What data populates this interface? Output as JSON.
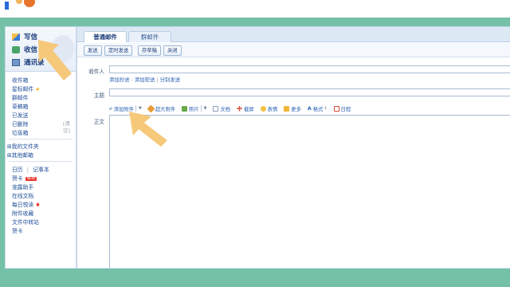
{
  "sidebar": {
    "quick": [
      {
        "label": "写信",
        "icon": "pen-icon"
      },
      {
        "label": "收信",
        "icon": "inbox-icon"
      },
      {
        "label": "通讯录",
        "icon": "address-book-icon"
      }
    ],
    "folders": [
      {
        "label": "收件箱"
      },
      {
        "label": "星标邮件",
        "star": "★"
      },
      {
        "label": "群邮件"
      },
      {
        "label": "草稿箱"
      },
      {
        "label": "已发送"
      },
      {
        "label": "已删除",
        "count": "[清空]"
      },
      {
        "label": "垃圾箱"
      }
    ],
    "groups": [
      {
        "label": "⊞我的文件夹"
      },
      {
        "label": "⊞其他邮箱"
      }
    ],
    "tools": {
      "calendar": "日历",
      "divider": "|",
      "notebook": "记事本",
      "postcard": "贺卡",
      "postcard_badge": "NEW",
      "reminder": "宠露助手",
      "docs": "在线文档",
      "daily": "每日悦读",
      "daily_mark": "●",
      "attach_fav": "附件收藏",
      "transfer": "文件中转站",
      "card": "贺卡"
    }
  },
  "main": {
    "tabs": [
      {
        "label": "普通邮件",
        "active": true
      },
      {
        "label": "群邮件",
        "active": false
      }
    ],
    "toolbar": {
      "send": "发送",
      "scheduled": "定时发送",
      "save_draft": "存草稿",
      "close": "关闭"
    },
    "recipient_label": "收件人",
    "recipient_links": {
      "cc": "添加抄送",
      "dot": "-",
      "bcc": "添加密送",
      "sep": "|",
      "separate": "分别发送"
    },
    "subject_label": "主题",
    "format": {
      "attach": "添加附件",
      "big_attach": "超大附件",
      "photo": "照片",
      "doc": "文档",
      "screenshot": "截屏",
      "emoji": "表情",
      "more": "更多",
      "style": "格式",
      "schedule": "日程"
    },
    "body_label": "正文"
  },
  "colors": {
    "background": "#74c1a8",
    "accent": "#1b3d7a",
    "link": "#2b62b3",
    "arrow": "#f6c87a"
  }
}
